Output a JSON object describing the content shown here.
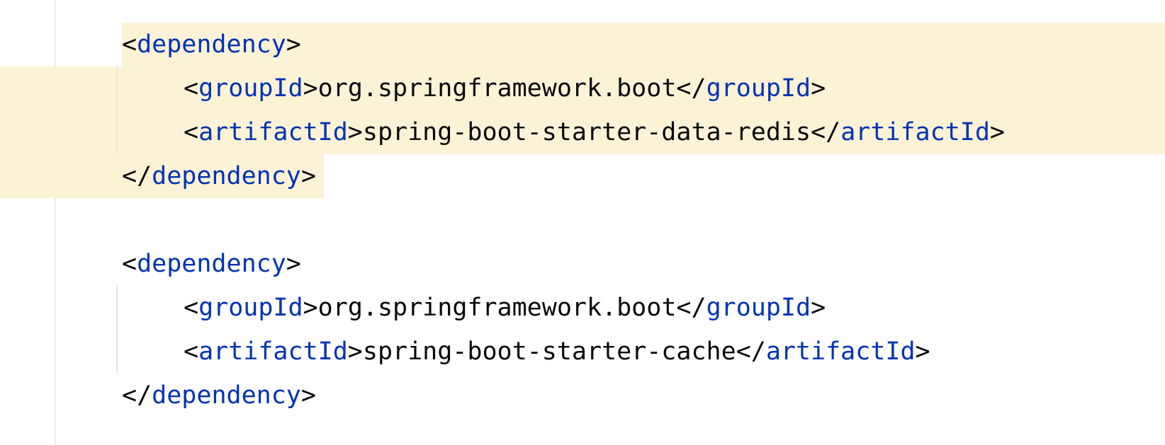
{
  "editor": {
    "language": "xml",
    "highlight_color": "#fcf3d7",
    "tag_color": "#0033b3",
    "text_color": "#080808",
    "lines": [
      {
        "open": "<",
        "tag": "dependency",
        "close": ">"
      },
      {
        "open": "<",
        "tag": "groupId",
        "close": ">",
        "text": "org.springframework.boot",
        "end_open": "</",
        "end_tag": "groupId",
        "end_close": ">"
      },
      {
        "open": "<",
        "tag": "artifactId",
        "close": ">",
        "text": "spring-boot-starter-data-redis",
        "end_open": "</",
        "end_tag": "artifactId",
        "end_close": ">"
      },
      {
        "open": "</",
        "tag": "dependency",
        "close": ">"
      },
      {
        "open": "<",
        "tag": "dependency",
        "close": ">"
      },
      {
        "open": "<",
        "tag": "groupId",
        "close": ">",
        "text": "org.springframework.boot",
        "end_open": "</",
        "end_tag": "groupId",
        "end_close": ">"
      },
      {
        "open": "<",
        "tag": "artifactId",
        "close": ">",
        "text": "spring-boot-starter-cache",
        "end_open": "</",
        "end_tag": "artifactId",
        "end_close": ">"
      },
      {
        "open": "</",
        "tag": "dependency",
        "close": ">"
      }
    ]
  }
}
